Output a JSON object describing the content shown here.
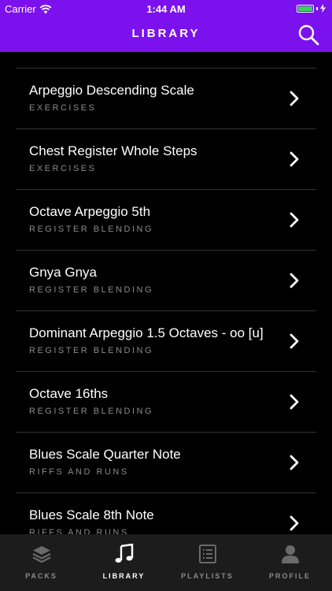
{
  "status_bar": {
    "carrier": "Carrier",
    "time": "1:44 AM",
    "battery_color": "#3bd359"
  },
  "header": {
    "title": "LIBRARY",
    "background": "#7b11ec",
    "search_icon": "search-icon"
  },
  "library": {
    "items": [
      {
        "title": "Arpeggio Descending Scale",
        "category": "EXERCISES"
      },
      {
        "title": "Chest Register Whole Steps",
        "category": "EXERCISES"
      },
      {
        "title": "Octave Arpeggio 5th",
        "category": "REGISTER BLENDING"
      },
      {
        "title": "Gnya Gnya",
        "category": "REGISTER BLENDING"
      },
      {
        "title": "Dominant Arpeggio 1.5 Octaves - oo [u]",
        "category": "REGISTER BLENDING"
      },
      {
        "title": "Octave 16ths",
        "category": "REGISTER BLENDING"
      },
      {
        "title": "Blues Scale Quarter Note",
        "category": "RIFFS AND RUNS"
      },
      {
        "title": "Blues Scale 8th Note",
        "category": "RIFFS AND RUNS"
      }
    ]
  },
  "tab_bar": {
    "tabs": [
      {
        "label": "PACKS",
        "icon": "layers-icon",
        "active": false
      },
      {
        "label": "LIBRARY",
        "icon": "music-note-icon",
        "active": true
      },
      {
        "label": "PLAYLISTS",
        "icon": "list-icon",
        "active": false
      },
      {
        "label": "PROFILE",
        "icon": "person-icon",
        "active": false
      }
    ]
  }
}
